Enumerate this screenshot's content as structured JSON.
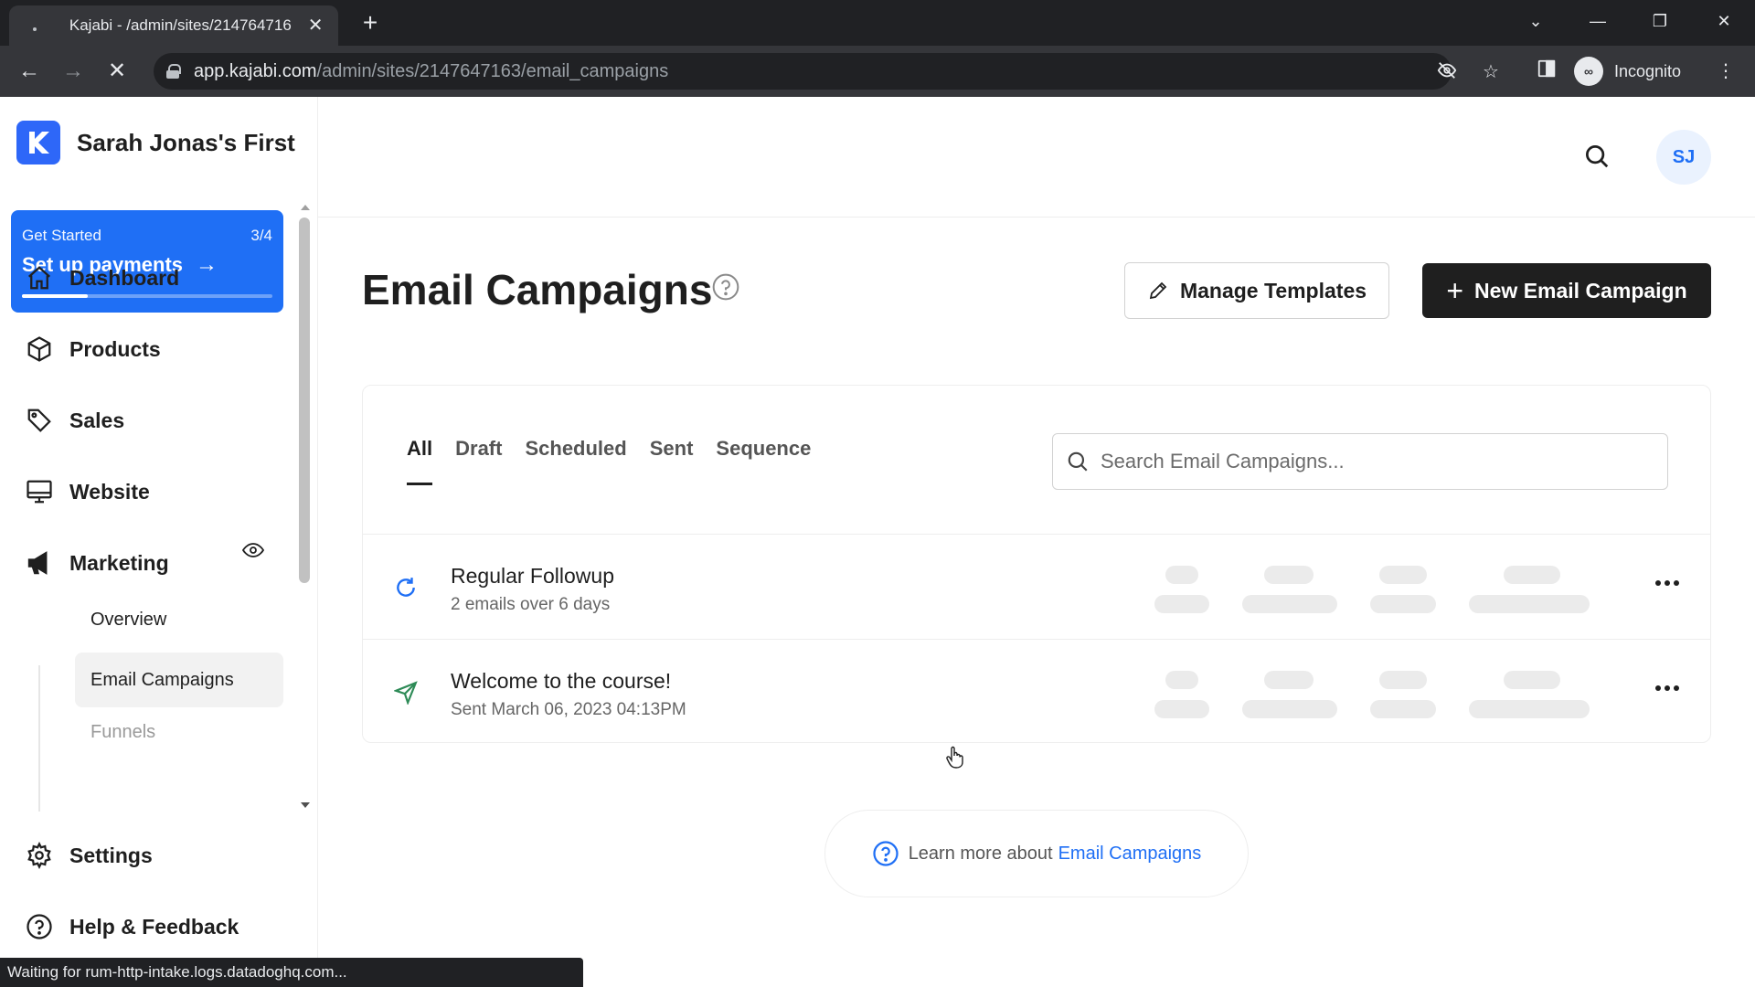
{
  "browser": {
    "tab_title": "Kajabi - /admin/sites/214764716",
    "tab_close": "✕",
    "new_tab": "+",
    "url_domain": "app.kajabi.com",
    "url_path": "/admin/sites/2147647163/email_campaigns",
    "incognito_label": "Incognito",
    "status_text": "Waiting for rum-http-intake.logs.datadoghq.com..."
  },
  "sidebar": {
    "site_name": "Sarah Jonas's First",
    "get_started": {
      "label": "Get Started",
      "progress_text": "3/4",
      "title": "Set up payments",
      "progress_fraction": 0.75
    },
    "nav": {
      "dashboard": "Dashboard",
      "products": "Products",
      "sales": "Sales",
      "website": "Website",
      "marketing": "Marketing",
      "settings": "Settings",
      "help": "Help & Feedback"
    },
    "marketing_sub": {
      "overview": "Overview",
      "email_campaigns": "Email Campaigns",
      "next_partial": "Funnels"
    }
  },
  "header": {
    "avatar_initials": "SJ"
  },
  "main": {
    "title": "Email Campaigns",
    "manage_templates": "Manage Templates",
    "new_campaign": "New Email Campaign",
    "tabs": [
      "All",
      "Draft",
      "Scheduled",
      "Sent",
      "Sequence"
    ],
    "active_tab": "All",
    "search_placeholder": "Search Email Campaigns...",
    "campaigns": [
      {
        "title": "Regular Followup",
        "subtitle": "2 emails over 6 days",
        "icon": "sequence-refresh-icon"
      },
      {
        "title": "Welcome to the course!",
        "subtitle": "Sent March 06, 2023 04:13PM",
        "icon": "sent-plane-icon"
      }
    ],
    "learn_more_prefix": "Learn more about",
    "learn_more_link": "Email Campaigns"
  },
  "colors": {
    "accent": "#1f6ff5",
    "brand_logo": "#2e67f8",
    "dark_button": "#1f1f1f",
    "sequence_icon": "#1f6ff5",
    "sent_icon": "#2e8b57"
  }
}
